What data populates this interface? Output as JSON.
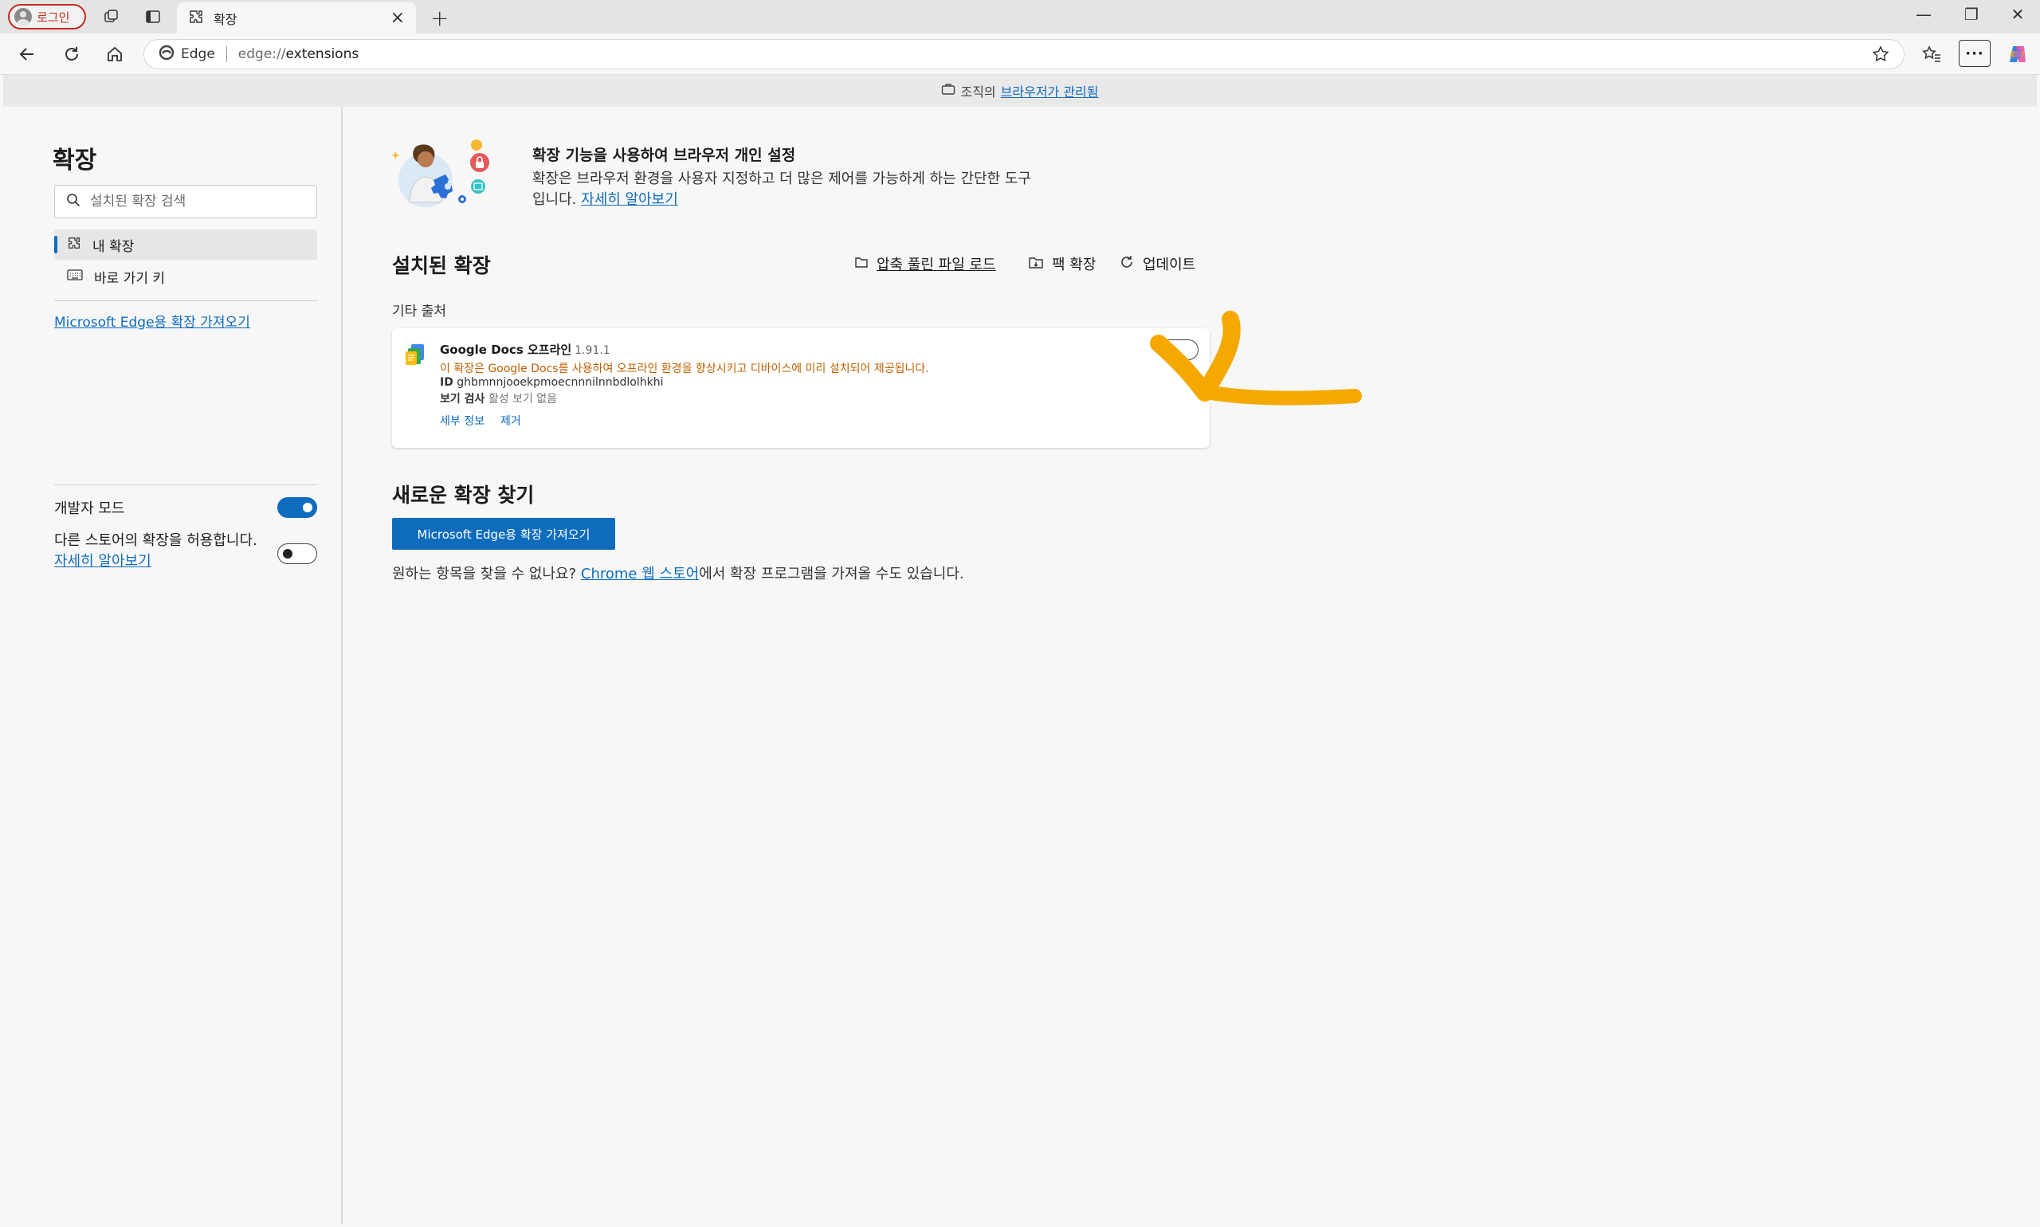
{
  "tabstrip": {
    "profile_label": "로그인",
    "tab_title": "확장",
    "new_tab": "+",
    "window_controls": [
      "—",
      "❐",
      "✕"
    ]
  },
  "toolbar": {
    "brand": "Edge",
    "url_scheme": "edge://",
    "url_path": "extensions",
    "more_label": "···"
  },
  "banner": {
    "prefix": "조직의",
    "link": "브라우저가 관리됨"
  },
  "sidebar": {
    "title": "확장",
    "search_placeholder": "설치된 확장 검색",
    "items": [
      {
        "label": "내 확장",
        "icon": "puzzle-icon",
        "active": true
      },
      {
        "label": "바로 가기 키",
        "icon": "keyboard-icon",
        "active": false
      }
    ],
    "store_link": "Microsoft Edge용 확장 가져오기",
    "developer_mode_label": "개발자 모드",
    "developer_mode_on": true,
    "allow_other_stores_label": "다른 스토어의 확장을 허용합니다.",
    "allow_other_stores_link": "자세히 알아보기",
    "allow_other_stores_on": false
  },
  "main": {
    "hero_title": "확장 기능을 사용하여 브라우저 개인 설정",
    "hero_desc_line1": "확장은 브라우저 환경을 사용자 지정하고 더 많은 제어를 가능하게 하는 간단한 도구",
    "hero_desc_line2": "입니다.",
    "hero_link": "자세히 알아보기",
    "installed_title": "설치된 확장",
    "actions": {
      "load_unpacked": "압축 풀린 파일 로드",
      "pack": "팩 확장",
      "update": "업데이트"
    },
    "other_sources": "기타 출처",
    "extension": {
      "name": "Google Docs 오프라인",
      "version": "1.91.1",
      "description": "이 확장은 Google Docs를 사용하여 오프라인 환경을 향상시키고 디바이스에 미리 설치되어 제공됩니다.",
      "id_label": "ID",
      "id_value": "ghbmnnjooekpmoecnnnilnnbdlolhkhi",
      "view_label": "보기 검사",
      "view_value": "활성 보기 없음",
      "details_link": "세부 정보",
      "remove_link": "제거",
      "enabled": false
    },
    "new_title": "새로운 확장 찾기",
    "get_button": "Microsoft Edge용 확장 가져오기",
    "find_prefix": "원하는 항목을 찾을 수 없나요?",
    "find_link": "Chrome 웹 스토어",
    "find_suffix": "에서 확장 프로그램을 가져올 수도 있습니다."
  },
  "colors": {
    "accent": "#0f6cbd",
    "warning_text": "#c06000",
    "annotation": "#f5a800",
    "profile_border": "#c42b1c"
  }
}
